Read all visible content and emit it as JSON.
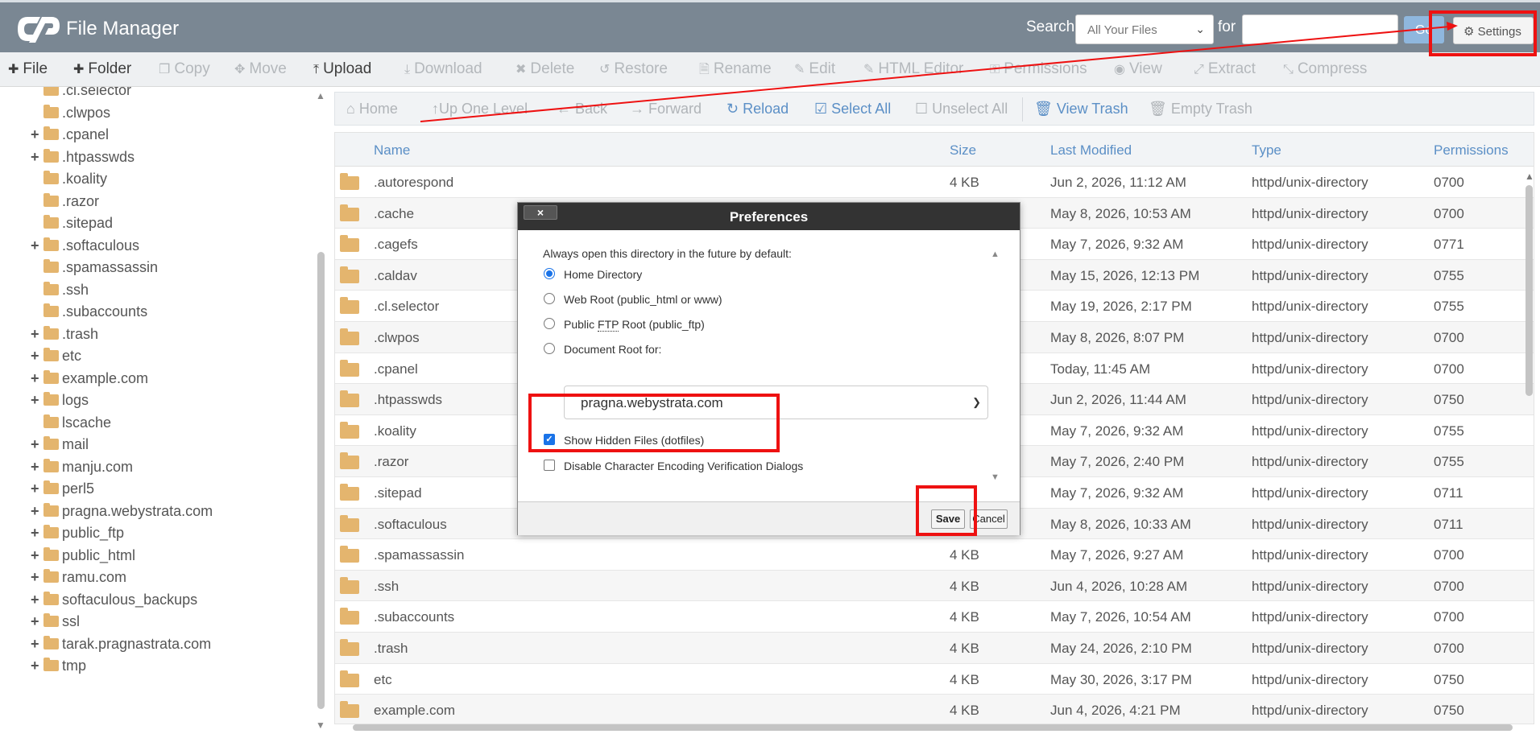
{
  "header": {
    "title": "File Manager",
    "search_label": "Search",
    "search_scope": "All Your Files",
    "for_label": "for",
    "search_value": "",
    "go_label": "Go",
    "settings_label": "Settings",
    "colors": {
      "header_bg": "#7a8793",
      "accent": "#5b8fc6",
      "annotation": "#ee1111"
    }
  },
  "toolbar": {
    "file": "File",
    "folder": "Folder",
    "copy": "Copy",
    "move": "Move",
    "upload": "Upload",
    "download": "Download",
    "delete": "Delete",
    "restore": "Restore",
    "rename": "Rename",
    "edit": "Edit",
    "html_editor": "HTML Editor",
    "permissions": "Permissions",
    "view": "View",
    "extract": "Extract",
    "compress": "Compress"
  },
  "tree": {
    "items": [
      {
        "label": ".cl.selector",
        "expandable": false
      },
      {
        "label": ".clwpos",
        "expandable": false
      },
      {
        "label": ".cpanel",
        "expandable": true
      },
      {
        "label": ".htpasswds",
        "expandable": true
      },
      {
        "label": ".koality",
        "expandable": false
      },
      {
        "label": ".razor",
        "expandable": false
      },
      {
        "label": ".sitepad",
        "expandable": false
      },
      {
        "label": ".softaculous",
        "expandable": true
      },
      {
        "label": ".spamassassin",
        "expandable": false
      },
      {
        "label": ".ssh",
        "expandable": false
      },
      {
        "label": ".subaccounts",
        "expandable": false
      },
      {
        "label": ".trash",
        "expandable": true
      },
      {
        "label": "etc",
        "expandable": true
      },
      {
        "label": "example.com",
        "expandable": true
      },
      {
        "label": "logs",
        "expandable": true
      },
      {
        "label": "lscache",
        "expandable": false
      },
      {
        "label": "mail",
        "expandable": true
      },
      {
        "label": "manju.com",
        "expandable": true
      },
      {
        "label": "perl5",
        "expandable": true
      },
      {
        "label": "pragna.webystrata.com",
        "expandable": true
      },
      {
        "label": "public_ftp",
        "expandable": true
      },
      {
        "label": "public_html",
        "expandable": true
      },
      {
        "label": "ramu.com",
        "expandable": true
      },
      {
        "label": "softaculous_backups",
        "expandable": true
      },
      {
        "label": "ssl",
        "expandable": true
      },
      {
        "label": "tarak.pragnastrata.com",
        "expandable": true
      },
      {
        "label": "tmp",
        "expandable": true
      }
    ]
  },
  "navbar": {
    "home": "Home",
    "up": "Up One Level",
    "back": "Back",
    "forward": "Forward",
    "reload": "Reload",
    "select_all": "Select All",
    "unselect_all": "Unselect All",
    "view_trash": "View Trash",
    "empty_trash": "Empty Trash"
  },
  "table": {
    "columns": [
      "Name",
      "Size",
      "Last Modified",
      "Type",
      "Permissions"
    ],
    "rows": [
      {
        "name": ".autorespond",
        "size": "4 KB",
        "modified": "Jun 2, 2026, 11:12 AM",
        "type": "httpd/unix-directory",
        "perms": "0700"
      },
      {
        "name": ".cache",
        "size": "",
        "modified": "May 8, 2026, 10:53 AM",
        "type": "httpd/unix-directory",
        "perms": "0700"
      },
      {
        "name": ".cagefs",
        "size": "",
        "modified": "May 7, 2026, 9:32 AM",
        "type": "httpd/unix-directory",
        "perms": "0771"
      },
      {
        "name": ".caldav",
        "size": "",
        "modified": "May 15, 2026, 12:13 PM",
        "type": "httpd/unix-directory",
        "perms": "0755"
      },
      {
        "name": ".cl.selector",
        "size": "",
        "modified": "May 19, 2026, 2:17 PM",
        "type": "httpd/unix-directory",
        "perms": "0755"
      },
      {
        "name": ".clwpos",
        "size": "",
        "modified": "May 8, 2026, 8:07 PM",
        "type": "httpd/unix-directory",
        "perms": "0700"
      },
      {
        "name": ".cpanel",
        "size": "",
        "modified": "Today, 11:45 AM",
        "type": "httpd/unix-directory",
        "perms": "0700"
      },
      {
        "name": ".htpasswds",
        "size": "",
        "modified": "Jun 2, 2026, 11:44 AM",
        "type": "httpd/unix-directory",
        "perms": "0750"
      },
      {
        "name": ".koality",
        "size": "",
        "modified": "May 7, 2026, 9:32 AM",
        "type": "httpd/unix-directory",
        "perms": "0755"
      },
      {
        "name": ".razor",
        "size": "",
        "modified": "May 7, 2026, 2:40 PM",
        "type": "httpd/unix-directory",
        "perms": "0755"
      },
      {
        "name": ".sitepad",
        "size": "",
        "modified": "May 7, 2026, 9:32 AM",
        "type": "httpd/unix-directory",
        "perms": "0711"
      },
      {
        "name": ".softaculous",
        "size": "",
        "modified": "May 8, 2026, 10:33 AM",
        "type": "httpd/unix-directory",
        "perms": "0711"
      },
      {
        "name": ".spamassassin",
        "size": "4 KB",
        "modified": "May 7, 2026, 9:27 AM",
        "type": "httpd/unix-directory",
        "perms": "0700"
      },
      {
        "name": ".ssh",
        "size": "4 KB",
        "modified": "Jun 4, 2026, 10:28 AM",
        "type": "httpd/unix-directory",
        "perms": "0700"
      },
      {
        "name": ".subaccounts",
        "size": "4 KB",
        "modified": "May 7, 2026, 10:54 AM",
        "type": "httpd/unix-directory",
        "perms": "0700"
      },
      {
        "name": ".trash",
        "size": "4 KB",
        "modified": "May 24, 2026, 2:10 PM",
        "type": "httpd/unix-directory",
        "perms": "0700"
      },
      {
        "name": "etc",
        "size": "4 KB",
        "modified": "May 30, 2026, 3:17 PM",
        "type": "httpd/unix-directory",
        "perms": "0750"
      },
      {
        "name": "example.com",
        "size": "4 KB",
        "modified": "Jun 4, 2026, 4:21 PM",
        "type": "httpd/unix-directory",
        "perms": "0750"
      }
    ]
  },
  "dialog": {
    "title": "Preferences",
    "close_label": "×",
    "prompt": "Always open this directory in the future by default:",
    "options": {
      "home": "Home Directory",
      "webroot": "Web Root (public_html or www)",
      "ftp_prefix": "Public ",
      "ftp_abbr": "FTP",
      "ftp_suffix": " Root (public_ftp)",
      "docroot": "Document Root for:"
    },
    "selected_option": "Home Directory",
    "docroot_value": "pragna.webystrata.com",
    "show_hidden_label": "Show Hidden Files (dotfiles)",
    "show_hidden_checked": true,
    "disable_encoding_label": "Disable Character Encoding Verification Dialogs",
    "disable_encoding_checked": false,
    "save_label": "Save",
    "cancel_label": "Cancel"
  }
}
